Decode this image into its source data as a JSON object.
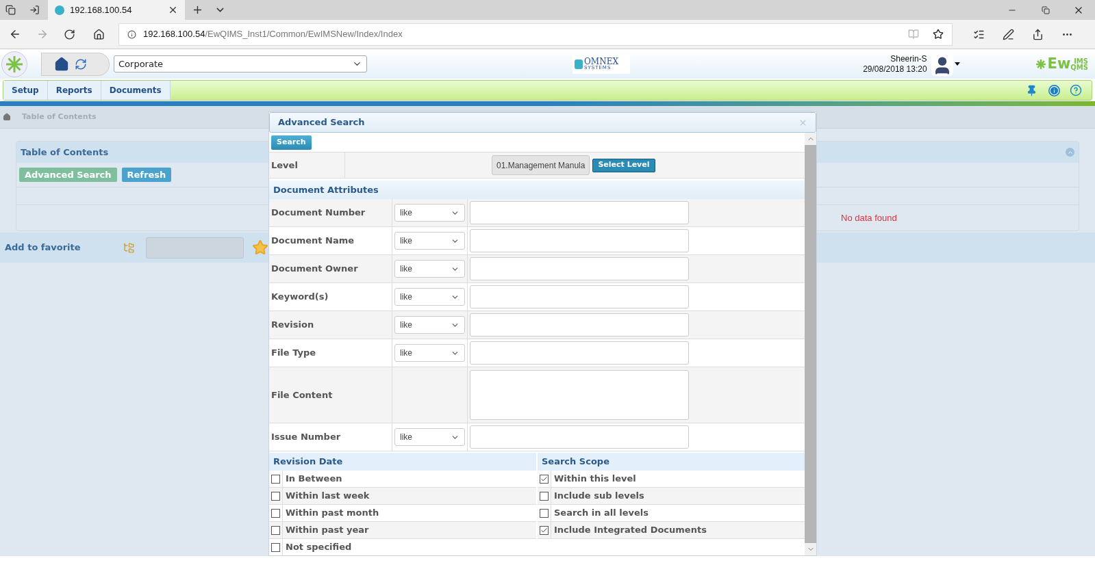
{
  "browser": {
    "tabs": [
      {
        "title": "192.168.100.54",
        "selected": true
      }
    ],
    "address": {
      "host": "192.168.100.54",
      "path": "/EwQIMS_Inst1/Common/EwIMSNew/Index/Index"
    }
  },
  "header": {
    "org_select": "Corporate",
    "logo": {
      "name": "OMNEX",
      "tagline": "SYSTEMS"
    },
    "user": "Sheerin-S",
    "datetime": "29/08/2018 13:20",
    "product_logo": {
      "main": "Ew",
      "top": "IMS",
      "bottom": "QMS"
    }
  },
  "menu": [
    {
      "label": "Setup"
    },
    {
      "label": "Reports"
    },
    {
      "label": "Documents"
    }
  ],
  "breadcrumb": [
    "Table of Contents"
  ],
  "toc_panel": {
    "title": "Table of Contents",
    "buttons": [
      {
        "label": "Advanced Search",
        "disabled": true
      },
      {
        "label": "Refresh",
        "disabled": false
      }
    ],
    "empty_message": "No data found"
  },
  "favorite": {
    "label": "Add to favorite"
  },
  "modal": {
    "title": "Advanced Search",
    "search_button": "Search",
    "level": {
      "label": "Level",
      "value": "01.Management Manula",
      "button": "Select Level"
    },
    "section": "Document Attributes",
    "fields": [
      {
        "label": "Document Number",
        "kind": "text",
        "operator": "like"
      },
      {
        "label": "Document Name",
        "kind": "text",
        "operator": "like"
      },
      {
        "label": "Document Owner",
        "kind": "text",
        "operator": "like"
      },
      {
        "label": "Keyword(s)",
        "kind": "text",
        "operator": "like"
      },
      {
        "label": "Revision",
        "kind": "text",
        "operator": "like"
      },
      {
        "label": "File Type",
        "kind": "text",
        "operator": "like"
      },
      {
        "label": "File Content",
        "kind": "textarea"
      },
      {
        "label": "Issue Number",
        "kind": "text",
        "operator": "like"
      }
    ],
    "revision_date": {
      "title": "Revision Date",
      "options": [
        {
          "label": "In Between",
          "checked": false
        },
        {
          "label": "Within last week",
          "checked": false
        },
        {
          "label": "Within past month",
          "checked": false
        },
        {
          "label": "Within past year",
          "checked": false
        },
        {
          "label": "Not specified",
          "checked": false
        }
      ]
    },
    "search_scope": {
      "title": "Search Scope",
      "options": [
        {
          "label": "Within this level",
          "checked": true
        },
        {
          "label": "Include sub levels",
          "checked": false
        },
        {
          "label": "Search in all levels",
          "checked": false
        },
        {
          "label": "Include Integrated Documents",
          "checked": true
        }
      ]
    }
  }
}
